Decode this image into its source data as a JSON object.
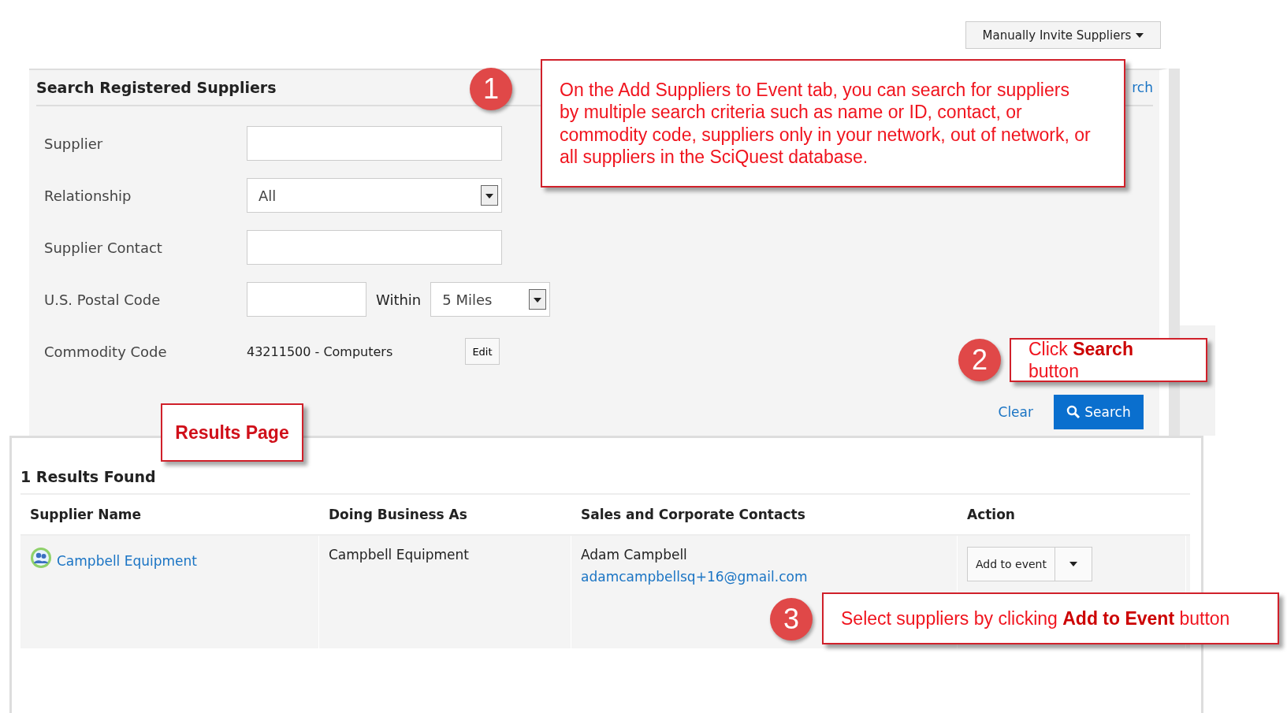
{
  "top_button": {
    "label": "Manually Invite Suppliers"
  },
  "search_panel": {
    "title": "Search Registered Suppliers",
    "link_fragment": "rch",
    "fields": [
      {
        "kind": "text",
        "label": "Supplier"
      },
      {
        "kind": "select",
        "label": "Relationship",
        "value": "All"
      },
      {
        "kind": "text",
        "label": "Supplier Contact"
      },
      {
        "kind": "postal",
        "label": "U.S. Postal Code",
        "within_label": "Within",
        "within_value": "5 Miles"
      },
      {
        "kind": "commodity",
        "label": "Commodity Code",
        "value": "43211500 - Computers",
        "button": "Edit"
      }
    ],
    "clear": "Clear",
    "search": "Search"
  },
  "results": {
    "count": "1 Results Found",
    "table": {
      "columns": [
        "Supplier Name",
        "Doing Business As",
        "Sales and Corporate Contacts",
        "Action"
      ],
      "rows": [
        {
          "supplier_name": "Campbell Equipment",
          "doing_business_as": "Campbell Equipment",
          "contact_name": "Adam Campbell",
          "contact_email": "adamcampbellsq+16@gmail.com",
          "action": "Add to event"
        }
      ]
    }
  },
  "callouts": [
    {
      "kind": "numbered",
      "number": "1",
      "text": "On the Add Suppliers to Event tab, you can search for suppliers by multiple search criteria such as name or ID, contact, or commodity code, suppliers only in your network, out of network, or all suppliers in the SciQuest database."
    },
    {
      "kind": "numbered",
      "number": "2",
      "text": "Click **Search** button"
    },
    {
      "kind": "label",
      "text": "Results Page"
    },
    {
      "kind": "numbered",
      "number": "3",
      "text": "Select suppliers by clicking **Add to Event** button"
    }
  ]
}
